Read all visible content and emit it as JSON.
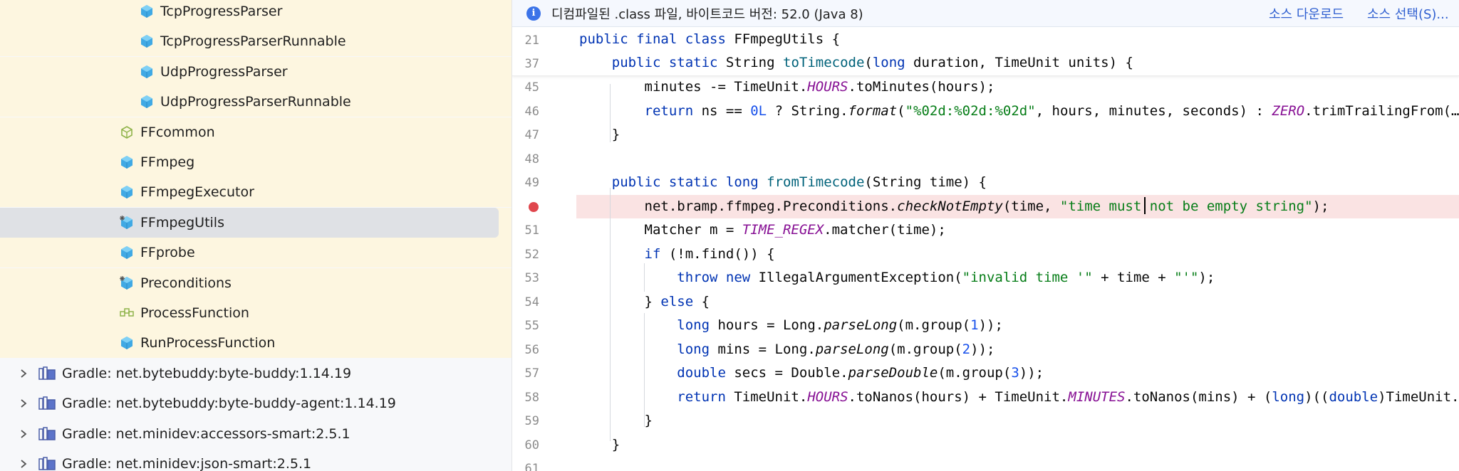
{
  "tree": {
    "items": [
      {
        "label": "TcpProgressParser",
        "icon": "class-icon"
      },
      {
        "label": "TcpProgressParserRunnable",
        "icon": "class-icon"
      },
      {
        "label": "UdpProgressParser",
        "icon": "class-icon"
      },
      {
        "label": "UdpProgressParserRunnable",
        "icon": "class-icon"
      },
      {
        "label": "FFcommon",
        "icon": "package-icon"
      },
      {
        "label": "FFmpeg",
        "icon": "class-icon"
      },
      {
        "label": "FFmpegExecutor",
        "icon": "class-icon"
      },
      {
        "label": "FFmpegUtils",
        "icon": "final-class-icon"
      },
      {
        "label": "FFprobe",
        "icon": "class-icon"
      },
      {
        "label": "Preconditions",
        "icon": "final-class-icon"
      },
      {
        "label": "ProcessFunction",
        "icon": "interface-icon"
      },
      {
        "label": "RunProcessFunction",
        "icon": "class-icon"
      }
    ],
    "libraries": [
      {
        "label": "Gradle: net.bytebuddy:byte-buddy:1.14.19"
      },
      {
        "label": "Gradle: net.bytebuddy:byte-buddy-agent:1.14.19"
      },
      {
        "label": "Gradle: net.minidev:accessors-smart:2.5.1"
      },
      {
        "label": "Gradle: net.minidev:json-smart:2.5.1"
      }
    ]
  },
  "banner": {
    "text": "디컴파일된 .class 파일, 바이트코드 버전: 52.0 (Java 8)",
    "download_label": "소스 다운로드",
    "choose_label": "소스 선택(S)..."
  },
  "editor": {
    "sticky_lines": [
      {
        "num": "21",
        "html": "<span class='kw'>public final class</span> FFmpegUtils {"
      },
      {
        "num": "37",
        "html": "    <span class='kw'>public static</span> String <span class='fn'>toTimecode</span>(<span class='kw'>long</span> duration, TimeUnit units) {"
      }
    ],
    "lines": [
      {
        "num": "45",
        "html": "        minutes -= TimeUnit.<span class='cst'>HOURS</span>.toMinutes(hours);"
      },
      {
        "num": "46",
        "html": "        <span class='kw'>return</span> ns == <span class='num'>0L</span> ? String.<span class='it'>format</span>(<span class='str'>\"%02d:%02d:%02d\"</span>, hours, minutes, seconds) : <span class='cst'>ZERO</span>.trimTrailingFrom(…"
      },
      {
        "num": "47",
        "html": "    }"
      },
      {
        "num": "48",
        "html": ""
      },
      {
        "num": "49",
        "html": "    <span class='kw'>public static long</span> <span class='fn'>fromTimecode</span>(String time) {"
      },
      {
        "num": "",
        "html": "        net.bramp.ffmpeg.Preconditions.<span class='it'>checkNotEmpty</span>(time, <span class='str'>\"time must not be empty string\"</span>);"
      },
      {
        "num": "51",
        "html": "        Matcher m = <span class='cst'>TIME_REGEX</span>.matcher(time);"
      },
      {
        "num": "52",
        "html": "        <span class='kw'>if</span> (!m.find()) {"
      },
      {
        "num": "53",
        "html": "            <span class='kw'>throw new</span> IllegalArgumentException(<span class='str'>\"invalid time '\"</span> + time + <span class='str'>\"'\"</span>);"
      },
      {
        "num": "54",
        "html": "        } <span class='kw'>else</span> {"
      },
      {
        "num": "55",
        "html": "            <span class='kw'>long</span> hours = Long.<span class='it'>parseLong</span>(m.group(<span class='num'>1</span>));"
      },
      {
        "num": "56",
        "html": "            <span class='kw'>long</span> mins = Long.<span class='it'>parseLong</span>(m.group(<span class='num'>2</span>));"
      },
      {
        "num": "57",
        "html": "            <span class='kw'>double</span> secs = Double.<span class='it'>parseDouble</span>(m.group(<span class='num'>3</span>));"
      },
      {
        "num": "58",
        "html": "            <span class='kw'>return</span> TimeUnit.<span class='cst'>HOURS</span>.toNanos(hours) + TimeUnit.<span class='cst'>MINUTES</span>.toNanos(mins) + (<span class='kw'>long</span>)((<span class='kw'>double</span>)TimeUnit.SEC…"
      },
      {
        "num": "59",
        "html": "        }"
      },
      {
        "num": "60",
        "html": "    }"
      },
      {
        "num": "61",
        "html": ""
      }
    ]
  },
  "colors": {
    "package_bg": "#fdf6e0",
    "selection": "#dfe1e5",
    "breakpoint": "#e0464d",
    "breakpoint_line": "#fae3e3",
    "class_icon": "#3fa9e0"
  }
}
